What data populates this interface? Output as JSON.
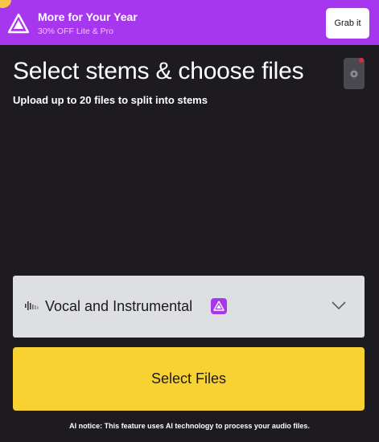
{
  "promo": {
    "title": "More for Your Year",
    "subtitle": "30% OFF Lite & Pro",
    "cta_label": "Grab it",
    "accent_color": "#a737ef",
    "logo_icon": "pyramid-logo-icon"
  },
  "main": {
    "title": "Select stems & choose files",
    "subtitle": "Upload up to 20 files to split into stems",
    "settings_icon": "settings-icon"
  },
  "stem_select": {
    "selected_value": "Vocal and Instrumental",
    "icon": "waveform-icon",
    "badge_icon": "pro-badge-icon",
    "chevron_icon": "chevron-down-icon"
  },
  "select_files": {
    "label": "Select Files",
    "color": "#f8d232"
  },
  "ai_notice": "AI notice: This feature uses AI technology to process your audio files."
}
